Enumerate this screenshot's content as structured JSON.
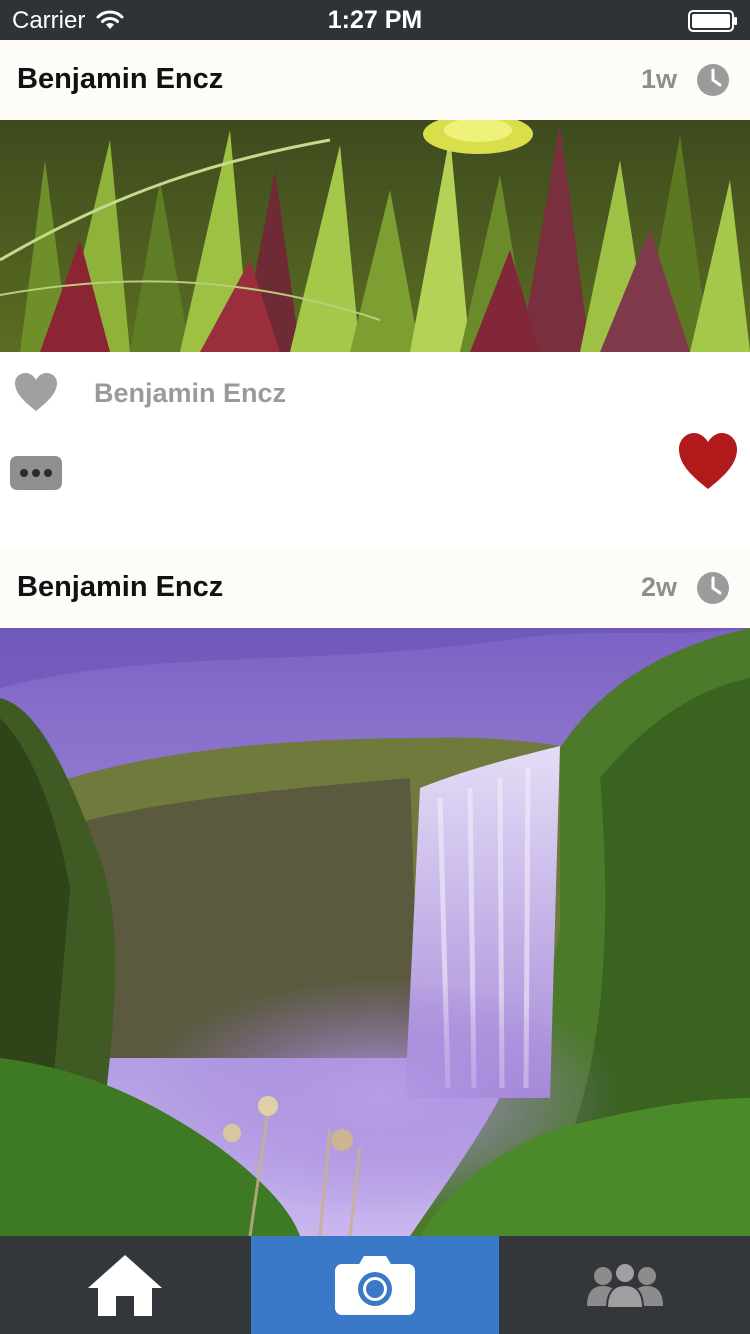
{
  "status_bar": {
    "carrier": "Carrier",
    "time": "1:27 PM",
    "icons": [
      "wifi-icon",
      "battery-icon"
    ]
  },
  "posts": [
    {
      "author": "Benjamin Encz",
      "age": "1w",
      "photo_subject": "green succulent plants",
      "liked_by": "Benjamin Encz",
      "liked": true
    },
    {
      "author": "Benjamin Encz",
      "age": "2w",
      "photo_subject": "waterfall"
    }
  ],
  "tab_bar": {
    "tabs": [
      {
        "icon": "home-icon",
        "selected": false
      },
      {
        "icon": "camera-icon",
        "selected": true
      },
      {
        "icon": "friends-icon",
        "selected": false
      }
    ],
    "selected_color": "#3a78c8",
    "background_color": "#33373c"
  },
  "colors": {
    "status_bar": "#2f3338",
    "header_bg": "#fdfcf8",
    "like_heart": "#b01a1a",
    "muted_text": "#9a9a9a"
  }
}
